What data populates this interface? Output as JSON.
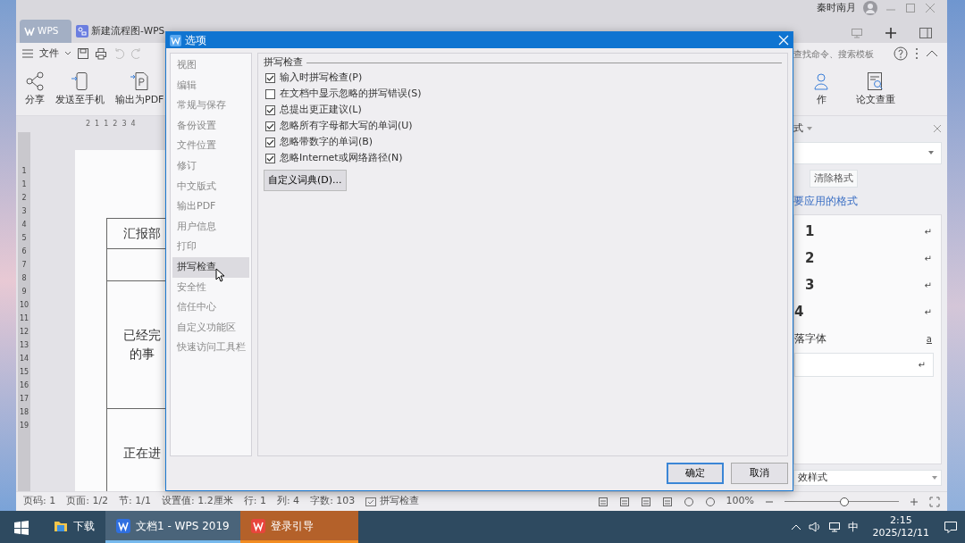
{
  "app": {
    "user": "秦时南月",
    "tabs": [
      {
        "label": "WPS",
        "kind": "home",
        "selected": false
      },
      {
        "label": "新建流程图-WPS",
        "kind": "flow",
        "selected": false
      }
    ],
    "menu": {
      "label": "文件"
    },
    "search": {
      "placeholder": "查找命令、搜索模板"
    },
    "ribbon_left": [
      {
        "label": "分享",
        "kind": "share"
      },
      {
        "label": "发送至手机",
        "kind": "phone"
      },
      {
        "label": "输出为PDF",
        "kind": "pdf"
      }
    ],
    "ribbon_right": [
      {
        "label": "作",
        "kind": "person"
      },
      {
        "label": "论文查重",
        "kind": "check"
      }
    ],
    "hruler": [
      "2",
      "1",
      "1",
      "2",
      "3",
      "4"
    ],
    "vruler": [
      "1",
      "1",
      "2",
      "3",
      "4",
      "5",
      "6",
      "7",
      "8",
      "9",
      "10",
      "11",
      "12",
      "13",
      "14",
      "15",
      "16",
      "17",
      "18",
      "19"
    ],
    "document": {
      "rows": [
        {
          "kind": "text",
          "lines": [
            "汇报部"
          ]
        },
        {
          "kind": "blank"
        },
        {
          "kind": "text",
          "lines": [
            "已经完",
            "的事"
          ]
        },
        {
          "kind": "text",
          "lines": [
            "正在进"
          ]
        }
      ]
    },
    "styles_pane": {
      "title": "式",
      "clear_button": "清除格式",
      "apply_label": "要应用的格式",
      "styles": [
        {
          "kind": "heading",
          "label": "1",
          "mark": "↵"
        },
        {
          "kind": "heading",
          "label": "2",
          "mark": "↵"
        },
        {
          "kind": "heading",
          "label": "3",
          "mark": "↵"
        },
        {
          "kind": "heading",
          "label": "4",
          "mark": "↵"
        },
        {
          "kind": "font",
          "label": "落字体",
          "mark": "a"
        },
        {
          "kind": "input",
          "mark": "↵"
        }
      ],
      "filter": "效样式"
    },
    "status_bar": {
      "items": [
        {
          "label": "页码: 1",
          "kind": "text"
        },
        {
          "label": "页面: 1/2",
          "kind": "text"
        },
        {
          "label": "节: 1/1",
          "kind": "text"
        },
        {
          "label": "设置值: 1.2厘米",
          "kind": "text"
        },
        {
          "label": "行: 1",
          "kind": "text"
        },
        {
          "label": "列: 4",
          "kind": "text"
        },
        {
          "label": "字数: 103",
          "kind": "text"
        },
        {
          "label": "拼写检查",
          "kind": "spell"
        }
      ],
      "zoom": "100%",
      "zoom_slider": {
        "level": 0.52
      }
    }
  },
  "dialog": {
    "title": "选项",
    "nav": [
      {
        "label": "视图",
        "selected": false
      },
      {
        "label": "编辑",
        "selected": false
      },
      {
        "label": "常规与保存",
        "selected": false
      },
      {
        "label": "备份设置",
        "selected": false
      },
      {
        "label": "文件位置",
        "selected": false
      },
      {
        "label": "修订",
        "selected": false
      },
      {
        "label": "中文版式",
        "selected": false
      },
      {
        "label": "输出PDF",
        "selected": false
      },
      {
        "label": "用户信息",
        "selected": false
      },
      {
        "label": "打印",
        "selected": false
      },
      {
        "label": "拼写检查",
        "selected": true
      },
      {
        "label": "安全性",
        "selected": false
      },
      {
        "label": "信任中心",
        "selected": false
      },
      {
        "label": "自定义功能区",
        "selected": false
      },
      {
        "label": "快速访问工具栏",
        "selected": false
      }
    ],
    "group": "拼写检查",
    "options": [
      {
        "label": "输入时拼写检查(P)",
        "checked": true
      },
      {
        "label": "在文档中显示忽略的拼写错误(S)",
        "checked": false
      },
      {
        "label": "总提出更正建议(L)",
        "checked": true
      },
      {
        "label": "忽略所有字母都大写的单词(U)",
        "checked": true
      },
      {
        "label": "忽略带数字的单词(B)",
        "checked": true
      },
      {
        "label": "忽略Internet或网络路径(N)",
        "checked": true
      }
    ],
    "dict_button": "自定义词典(D)...",
    "buttons": [
      {
        "label": "确定",
        "default": true
      },
      {
        "label": "取消",
        "default": false
      }
    ]
  },
  "taskbar": {
    "items": [
      {
        "label": "下载",
        "kind": "folder",
        "selected": false,
        "flashing": false
      },
      {
        "label": "文档1 - WPS 2019",
        "kind": "wps",
        "selected": true,
        "flashing": false
      },
      {
        "label": "登录引导",
        "kind": "wps",
        "selected": false,
        "flashing": true
      }
    ],
    "ime": "中",
    "time": "2:15",
    "date": "2025/12/11"
  }
}
